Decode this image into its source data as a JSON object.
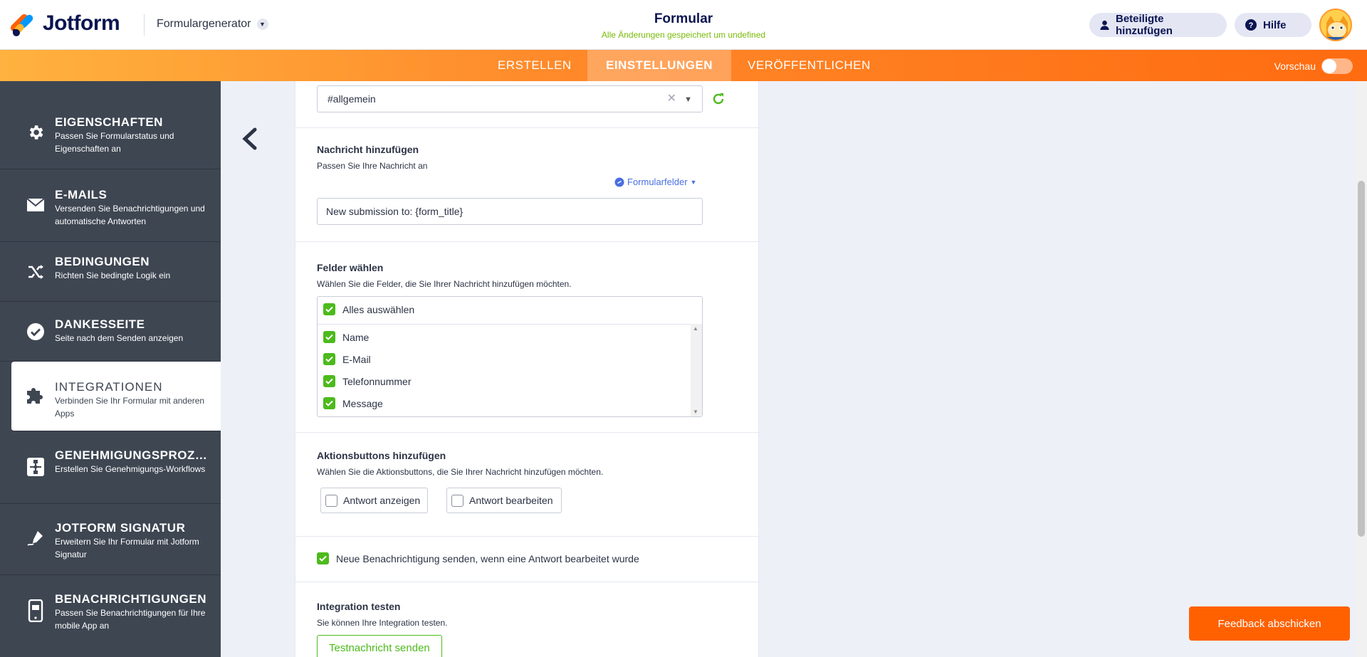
{
  "header": {
    "brand": "Jotform",
    "generator": "Formulargenerator",
    "form_title": "Formular",
    "saved_status": "Alle Änderungen gespeichert um undefined",
    "invite_label": "Beteiligte hinzufügen",
    "help_label": "Hilfe"
  },
  "nav": {
    "tabs": [
      "ERSTELLEN",
      "EINSTELLUNGEN",
      "VERÖFFENTLICHEN"
    ],
    "active": "EINSTELLUNGEN",
    "preview_label": "Vorschau"
  },
  "sidebar": {
    "items": [
      {
        "title": "EIGENSCHAFTEN",
        "subtitle": "Passen Sie Formularstatus und Eigenschaften an",
        "icon": "gear-icon"
      },
      {
        "title": "E-MAILS",
        "subtitle": "Versenden Sie Benachrichtigungen und automatische Antworten",
        "icon": "mail-icon"
      },
      {
        "title": "BEDINGUNGEN",
        "subtitle": "Richten Sie bedingte Logik ein",
        "icon": "shuffle-icon"
      },
      {
        "title": "DANKESSEITE",
        "subtitle": "Seite nach dem Senden anzeigen",
        "icon": "check-circle-icon"
      },
      {
        "title": "INTEGRATIONEN",
        "subtitle": "Verbinden Sie Ihr Formular mit anderen Apps",
        "icon": "puzzle-icon"
      },
      {
        "title": "GENEHMIGUNGSPROZES...",
        "subtitle": "Erstellen Sie Genehmigungs-Workflows",
        "icon": "workflow-icon"
      },
      {
        "title": "JOTFORM SIGNATUR",
        "subtitle": "Erweitern Sie Ihr Formular mit Jotform Signatur",
        "icon": "signature-pen-icon"
      },
      {
        "title": "BENACHRICHTIGUNGEN",
        "subtitle": "Passen Sie Benachrichtigungen für Ihre mobile App an",
        "icon": "mobile-icon"
      }
    ],
    "active_index": 4
  },
  "panel": {
    "channel_value": "#allgemein",
    "message": {
      "heading": "Nachricht hinzufügen",
      "desc": "Passen Sie Ihre Nachricht an",
      "form_fields_label": "Formularfelder",
      "value": "New submission to: {form_title}"
    },
    "fields": {
      "heading": "Felder wählen",
      "desc": "Wählen Sie die Felder, die Sie Ihrer Nachricht hinzufügen möchten.",
      "select_all": "Alles auswählen",
      "items": [
        "Name",
        "E-Mail",
        "Telefonnummer",
        "Message"
      ]
    },
    "actions": {
      "heading": "Aktionsbuttons hinzufügen",
      "desc": "Wählen Sie die Aktionsbuttons, die Sie Ihrer Nachricht hinzufügen möchten.",
      "buttons": [
        "Antwort anzeigen",
        "Antwort bearbeiten"
      ]
    },
    "resend_label": "Neue Benachrichtigung senden, wenn eine Antwort bearbeitet wurde",
    "test": {
      "heading": "Integration testen",
      "desc": "Sie können Ihre Integration testen.",
      "button": "Testnachricht senden"
    }
  },
  "feedback_label": "Feedback abschicken",
  "colors": {
    "brand_orange": "#ff6100",
    "sidebar_bg": "#3e4652",
    "check_green": "#4cba1c",
    "saved_green": "#78bb07",
    "link_blue": "#4a6ee0"
  }
}
